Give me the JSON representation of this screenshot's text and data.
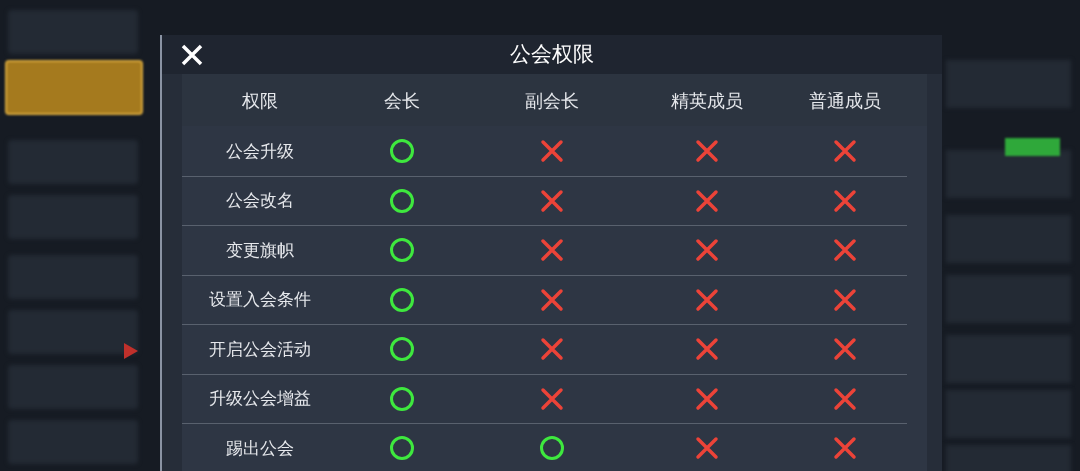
{
  "dialog": {
    "title": "公会权限"
  },
  "columns": [
    "权限",
    "会长",
    "副会长",
    "精英成员",
    "普通成员"
  ],
  "rows": [
    {
      "name": "公会升级",
      "cells": [
        {
          "allowed": true
        },
        {
          "allowed": false
        },
        {
          "allowed": false
        },
        {
          "allowed": false
        }
      ]
    },
    {
      "name": "公会改名",
      "cells": [
        {
          "allowed": true
        },
        {
          "allowed": false
        },
        {
          "allowed": false
        },
        {
          "allowed": false
        }
      ]
    },
    {
      "name": "变更旗帜",
      "cells": [
        {
          "allowed": true
        },
        {
          "allowed": false
        },
        {
          "allowed": false
        },
        {
          "allowed": false
        }
      ]
    },
    {
      "name": "设置入会条件",
      "cells": [
        {
          "allowed": true
        },
        {
          "allowed": false
        },
        {
          "allowed": false
        },
        {
          "allowed": false
        }
      ]
    },
    {
      "name": "开启公会活动",
      "cells": [
        {
          "allowed": true
        },
        {
          "allowed": false
        },
        {
          "allowed": false
        },
        {
          "allowed": false
        }
      ]
    },
    {
      "name": "升级公会增益",
      "cells": [
        {
          "allowed": true
        },
        {
          "allowed": false
        },
        {
          "allowed": false
        },
        {
          "allowed": false
        }
      ]
    },
    {
      "name": "踢出公会",
      "cells": [
        {
          "allowed": true
        },
        {
          "allowed": true
        },
        {
          "allowed": false
        },
        {
          "allowed": false
        }
      ]
    }
  ]
}
